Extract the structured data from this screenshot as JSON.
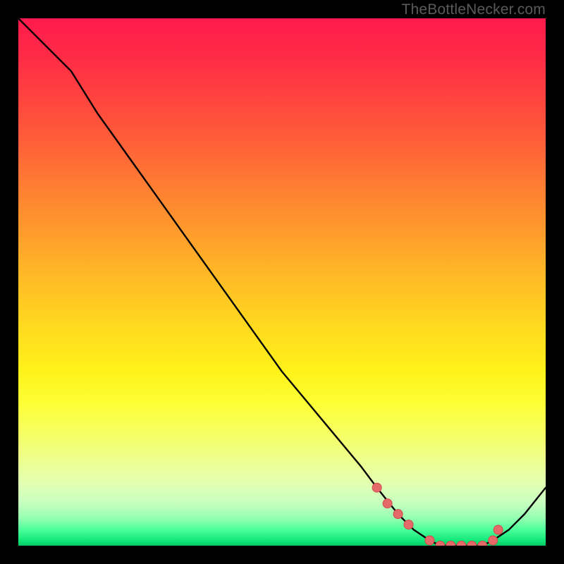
{
  "attribution": "TheBottleNecker.com",
  "colors": {
    "frame": "#000000",
    "attribution_text": "#5a5a5a",
    "curve_stroke": "#000000",
    "marker_fill": "#e46a6a",
    "marker_stroke": "#d24a4a",
    "gradient_stops": [
      {
        "offset": 0,
        "color": "#ff1a4d"
      },
      {
        "offset": 0.5,
        "color": "#ffe01a"
      },
      {
        "offset": 0.93,
        "color": "#c7ffc0"
      },
      {
        "offset": 1.0,
        "color": "#07c864"
      }
    ]
  },
  "chart_data": {
    "type": "line",
    "title": "",
    "xlabel": "",
    "ylabel": "",
    "xlim": [
      0,
      100
    ],
    "ylim": [
      0,
      100
    ],
    "legend": false,
    "grid": false,
    "x": [
      0,
      5,
      10,
      15,
      20,
      25,
      30,
      35,
      40,
      45,
      50,
      55,
      60,
      65,
      68,
      72,
      75,
      78,
      80,
      83,
      86,
      88,
      90,
      93,
      96,
      100
    ],
    "y": [
      100,
      95,
      90,
      82,
      75,
      68,
      61,
      54,
      47,
      40,
      33,
      27,
      21,
      15,
      11,
      6,
      3,
      1,
      0,
      0,
      0,
      0,
      1,
      3,
      6,
      11
    ],
    "markers": {
      "x": [
        68,
        70,
        72,
        74,
        78,
        80,
        82,
        84,
        86,
        88,
        90,
        91
      ],
      "y": [
        11,
        8,
        6,
        4,
        1,
        0,
        0,
        0,
        0,
        0,
        1,
        3
      ]
    }
  }
}
